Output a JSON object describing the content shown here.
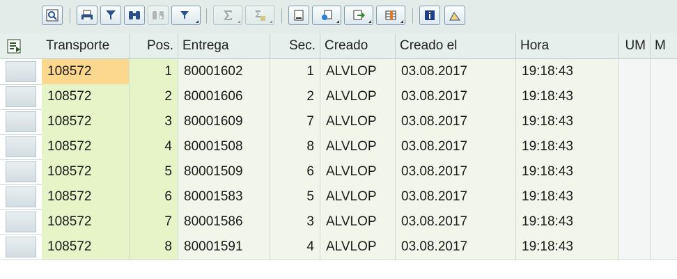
{
  "toolbar": {
    "buttons": [
      {
        "name": "details-button",
        "icon": "magnifier-detail-icon"
      },
      {
        "name": "print-preview-button",
        "icon": "printer-icon"
      },
      {
        "name": "filter-set-button",
        "icon": "funnel-icon"
      },
      {
        "name": "find-button",
        "icon": "binoculars-icon"
      },
      {
        "name": "find-next-button",
        "icon": "binoculars-next-icon"
      },
      {
        "name": "filter-button",
        "icon": "filter-icon"
      },
      {
        "name": "total-button",
        "icon": "sigma-icon"
      },
      {
        "name": "subtotal-button",
        "icon": "subtotal-icon"
      },
      {
        "name": "print-button",
        "icon": "print-icon"
      },
      {
        "name": "views-button",
        "icon": "views-icon"
      },
      {
        "name": "export-button",
        "icon": "export-icon"
      },
      {
        "name": "layout-button",
        "icon": "layout-grid-icon"
      },
      {
        "name": "info-button",
        "icon": "info-icon"
      },
      {
        "name": "graphic-button",
        "icon": "chart-icon"
      }
    ]
  },
  "grid": {
    "columns": [
      "Transporte",
      "Pos.",
      "Entrega",
      "Sec.",
      "Creado",
      "Creado el",
      "Hora",
      "UM",
      "M"
    ],
    "rows": [
      {
        "transporte": "108572",
        "pos": "1",
        "entrega": "80001602",
        "sec": "1",
        "creado": "ALVLOP",
        "creado_el": "03.08.2017",
        "hora": "19:18:43"
      },
      {
        "transporte": "108572",
        "pos": "2",
        "entrega": "80001606",
        "sec": "2",
        "creado": "ALVLOP",
        "creado_el": "03.08.2017",
        "hora": "19:18:43"
      },
      {
        "transporte": "108572",
        "pos": "3",
        "entrega": "80001609",
        "sec": "7",
        "creado": "ALVLOP",
        "creado_el": "03.08.2017",
        "hora": "19:18:43"
      },
      {
        "transporte": "108572",
        "pos": "4",
        "entrega": "80001508",
        "sec": "8",
        "creado": "ALVLOP",
        "creado_el": "03.08.2017",
        "hora": "19:18:43"
      },
      {
        "transporte": "108572",
        "pos": "5",
        "entrega": "80001509",
        "sec": "6",
        "creado": "ALVLOP",
        "creado_el": "03.08.2017",
        "hora": "19:18:43"
      },
      {
        "transporte": "108572",
        "pos": "6",
        "entrega": "80001583",
        "sec": "5",
        "creado": "ALVLOP",
        "creado_el": "03.08.2017",
        "hora": "19:18:43"
      },
      {
        "transporte": "108572",
        "pos": "7",
        "entrega": "80001586",
        "sec": "3",
        "creado": "ALVLOP",
        "creado_el": "03.08.2017",
        "hora": "19:18:43"
      },
      {
        "transporte": "108572",
        "pos": "8",
        "entrega": "80001591",
        "sec": "4",
        "creado": "ALVLOP",
        "creado_el": "03.08.2017",
        "hora": "19:18:43"
      }
    ]
  },
  "colors": {
    "key_column": "#e7f4c8",
    "focused_cell": "#fcd78e",
    "header": "#e6efec"
  }
}
